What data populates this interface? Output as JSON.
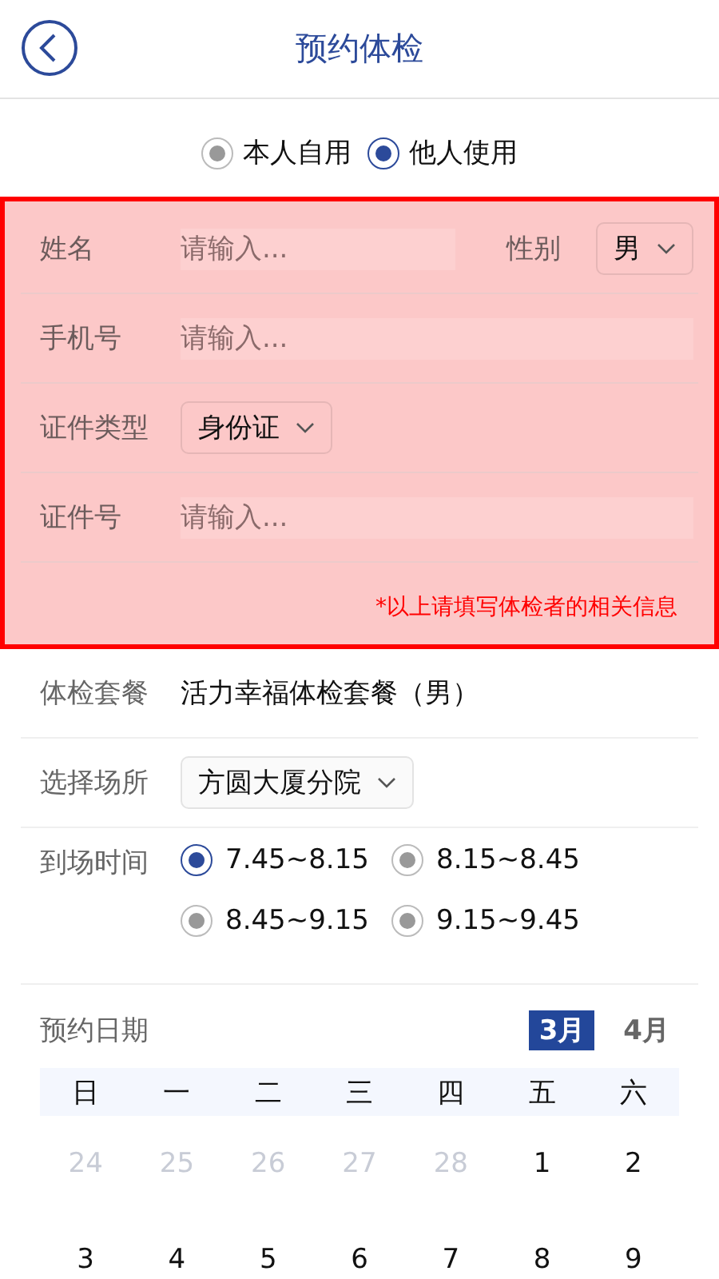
{
  "header": {
    "title": "预约体检"
  },
  "user_type": [
    {
      "label": "本人自用",
      "selected": false
    },
    {
      "label": "他人使用",
      "selected": true
    }
  ],
  "highlighted_form": {
    "name": {
      "label": "姓名",
      "placeholder": "请输入..."
    },
    "gender": {
      "label": "性别",
      "value": "男"
    },
    "phone": {
      "label": "手机号",
      "placeholder": "请输入..."
    },
    "id_type": {
      "label": "证件类型",
      "value": "身份证"
    },
    "id_number": {
      "label": "证件号",
      "placeholder": "请输入..."
    },
    "note": "*以上请填写体检者的相关信息"
  },
  "package": {
    "label": "体检套餐",
    "value": "活力幸福体检套餐（男）"
  },
  "venue": {
    "label": "选择场所",
    "value": "方圆大厦分院"
  },
  "arrival_time": {
    "label": "到场时间",
    "options": [
      {
        "label": "7.45~8.15",
        "selected": true
      },
      {
        "label": "8.15~8.45",
        "selected": false
      },
      {
        "label": "8.45~9.15",
        "selected": false
      },
      {
        "label": "9.15~9.45",
        "selected": false
      }
    ]
  },
  "calendar": {
    "label": "预约日期",
    "months": [
      {
        "label": "3月",
        "selected": true
      },
      {
        "label": "4月",
        "selected": false
      }
    ],
    "weekdays": [
      "日",
      "一",
      "二",
      "三",
      "四",
      "五",
      "六"
    ],
    "weeks": [
      [
        {
          "day": "24",
          "other_month": true
        },
        {
          "day": "25",
          "other_month": true
        },
        {
          "day": "26",
          "other_month": true
        },
        {
          "day": "27",
          "other_month": true
        },
        {
          "day": "28",
          "other_month": true
        },
        {
          "day": "1",
          "other_month": false
        },
        {
          "day": "2",
          "other_month": false
        }
      ],
      [
        {
          "day": "3",
          "other_month": false
        },
        {
          "day": "4",
          "other_month": false
        },
        {
          "day": "5",
          "other_month": false
        },
        {
          "day": "6",
          "other_month": false
        },
        {
          "day": "7",
          "other_month": false
        },
        {
          "day": "8",
          "other_month": false
        },
        {
          "day": "9",
          "other_month": false
        }
      ]
    ]
  }
}
